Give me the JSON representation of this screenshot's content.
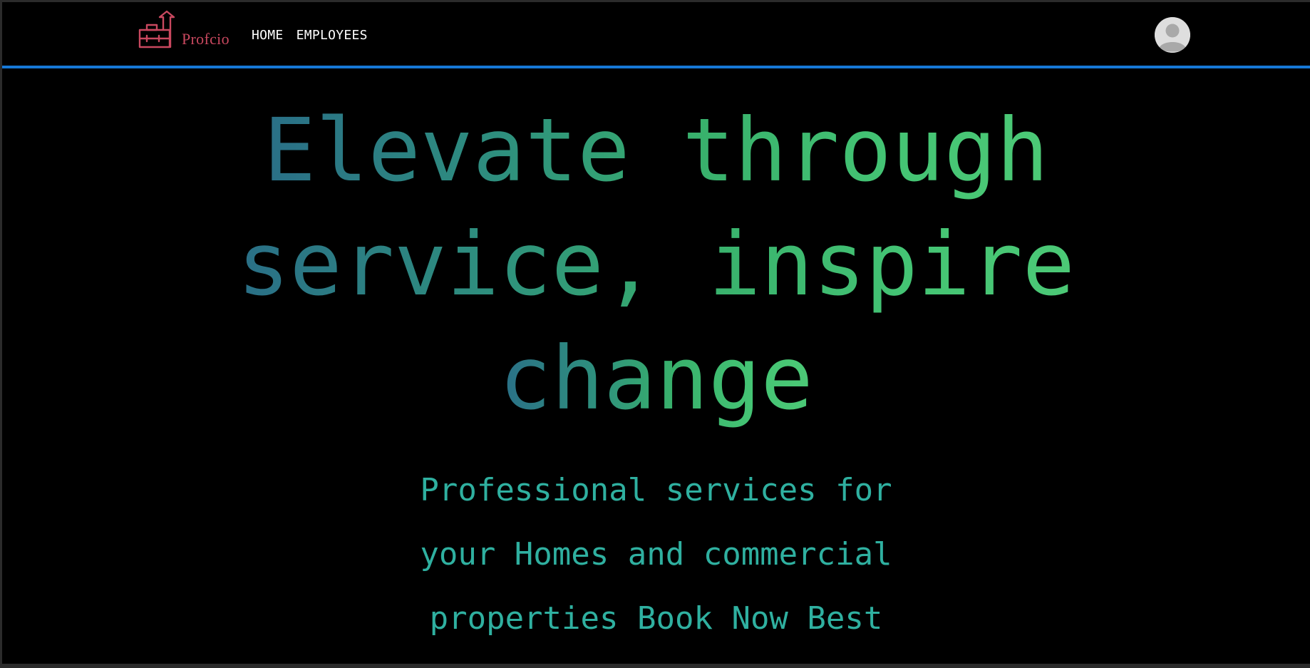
{
  "brand": {
    "name": "Profcio",
    "color": "#c9485f",
    "icon": "toolbox-arrow-icon"
  },
  "nav": {
    "items": [
      {
        "label": "HOME"
      },
      {
        "label": "EMPLOYEES"
      }
    ],
    "border_color": "#1778d6"
  },
  "user": {
    "avatar_icon": "user-avatar-icon"
  },
  "hero": {
    "title_lines": [
      "Elevate through",
      "service, inspire",
      "change"
    ],
    "subtitle_lines": [
      "Professional services for",
      "your Homes and commercial",
      "properties Book Now Best"
    ],
    "title_gradient": [
      "#2a6f87",
      "#4cc976"
    ],
    "subtitle_color": "#2fb0a0"
  }
}
